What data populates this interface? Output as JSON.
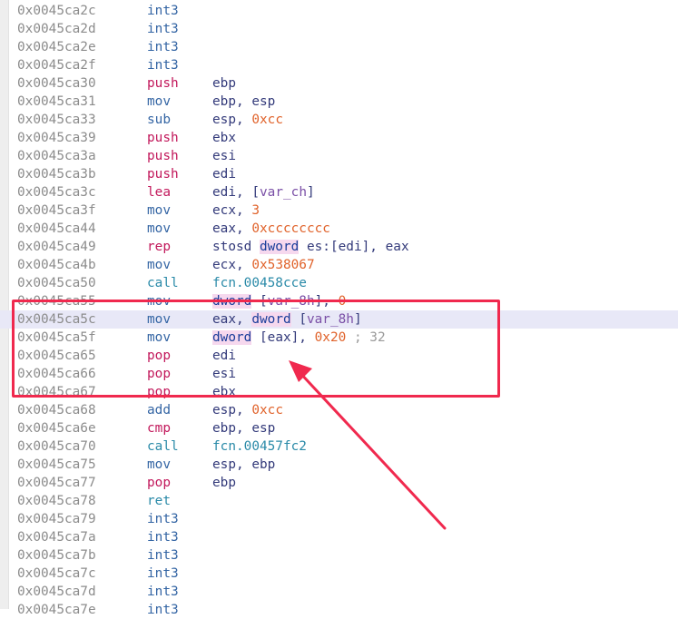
{
  "colors": {
    "highlight_box": "#f0294e",
    "selected_row": "#e8e8f7",
    "address": "#8c8c8c",
    "number": "#e0622a",
    "variable": "#7a4fa6"
  },
  "rows": [
    {
      "addr": "0x0045ca2c",
      "mn": "int3",
      "cls": "int",
      "ops": []
    },
    {
      "addr": "0x0045ca2d",
      "mn": "int3",
      "cls": "int",
      "ops": []
    },
    {
      "addr": "0x0045ca2e",
      "mn": "int3",
      "cls": "int",
      "ops": []
    },
    {
      "addr": "0x0045ca2f",
      "mn": "int3",
      "cls": "int",
      "ops": []
    },
    {
      "addr": "0x0045ca30",
      "mn": "push",
      "cls": "push",
      "ops": [
        [
          "reg",
          "ebp"
        ]
      ]
    },
    {
      "addr": "0x0045ca31",
      "mn": "mov",
      "cls": "mov",
      "ops": [
        [
          "reg",
          "ebp"
        ],
        [
          "punc",
          ", "
        ],
        [
          "reg",
          "esp"
        ]
      ]
    },
    {
      "addr": "0x0045ca33",
      "mn": "sub",
      "cls": "sub",
      "ops": [
        [
          "reg",
          "esp"
        ],
        [
          "punc",
          ", "
        ],
        [
          "num",
          "0xcc"
        ]
      ]
    },
    {
      "addr": "0x0045ca39",
      "mn": "push",
      "cls": "push",
      "ops": [
        [
          "reg",
          "ebx"
        ]
      ]
    },
    {
      "addr": "0x0045ca3a",
      "mn": "push",
      "cls": "push",
      "ops": [
        [
          "reg",
          "esi"
        ]
      ]
    },
    {
      "addr": "0x0045ca3b",
      "mn": "push",
      "cls": "push",
      "ops": [
        [
          "reg",
          "edi"
        ]
      ]
    },
    {
      "addr": "0x0045ca3c",
      "mn": "lea",
      "cls": "lea",
      "ops": [
        [
          "reg",
          "edi"
        ],
        [
          "punc",
          ", ["
        ],
        [
          "var",
          "var_ch"
        ],
        [
          "punc",
          "]"
        ]
      ]
    },
    {
      "addr": "0x0045ca3f",
      "mn": "mov",
      "cls": "mov",
      "ops": [
        [
          "reg",
          "ecx"
        ],
        [
          "punc",
          ", "
        ],
        [
          "num",
          "3"
        ]
      ]
    },
    {
      "addr": "0x0045ca44",
      "mn": "mov",
      "cls": "mov",
      "ops": [
        [
          "reg",
          "eax"
        ],
        [
          "punc",
          ", "
        ],
        [
          "num",
          "0xcccccccc"
        ]
      ]
    },
    {
      "addr": "0x0045ca49",
      "mn": "rep",
      "cls": "rep",
      "ops": [
        [
          "reg",
          "stosd "
        ],
        [
          "kw",
          "dword"
        ],
        [
          "punc",
          " es:[edi], eax"
        ]
      ]
    },
    {
      "addr": "0x0045ca4b",
      "mn": "mov",
      "cls": "mov",
      "ops": [
        [
          "reg",
          "ecx"
        ],
        [
          "punc",
          ", "
        ],
        [
          "num",
          "0x538067"
        ]
      ]
    },
    {
      "addr": "0x0045ca50",
      "mn": "call",
      "cls": "call",
      "ops": [
        [
          "fcn",
          "fcn.00458cce"
        ]
      ]
    },
    {
      "addr": "0x0045ca55",
      "mn": "mov",
      "cls": "mov",
      "ops": [
        [
          "kw",
          "dword"
        ],
        [
          "punc",
          " ["
        ],
        [
          "var",
          "var_8h"
        ],
        [
          "punc",
          "], "
        ],
        [
          "num",
          "0"
        ]
      ]
    },
    {
      "addr": "0x0045ca5c",
      "mn": "mov",
      "cls": "mov",
      "hl": true,
      "ops": [
        [
          "reg",
          "eax"
        ],
        [
          "punc",
          ", "
        ],
        [
          "kw",
          "dword"
        ],
        [
          "punc",
          " ["
        ],
        [
          "var",
          "var_8h"
        ],
        [
          "punc",
          "]"
        ]
      ]
    },
    {
      "addr": "0x0045ca5f",
      "mn": "mov",
      "cls": "mov",
      "ops": [
        [
          "kw",
          "dword"
        ],
        [
          "punc",
          " [eax], "
        ],
        [
          "num",
          "0x20"
        ],
        [
          "cmt",
          " ; 32"
        ]
      ]
    },
    {
      "addr": "0x0045ca65",
      "mn": "pop",
      "cls": "pop",
      "ops": [
        [
          "reg",
          "edi"
        ]
      ]
    },
    {
      "addr": "0x0045ca66",
      "mn": "pop",
      "cls": "pop",
      "ops": [
        [
          "reg",
          "esi"
        ]
      ]
    },
    {
      "addr": "0x0045ca67",
      "mn": "pop",
      "cls": "pop",
      "ops": [
        [
          "reg",
          "ebx"
        ]
      ]
    },
    {
      "addr": "0x0045ca68",
      "mn": "add",
      "cls": "add",
      "ops": [
        [
          "reg",
          "esp"
        ],
        [
          "punc",
          ", "
        ],
        [
          "num",
          "0xcc"
        ]
      ]
    },
    {
      "addr": "0x0045ca6e",
      "mn": "cmp",
      "cls": "cmp",
      "ops": [
        [
          "reg",
          "ebp"
        ],
        [
          "punc",
          ", "
        ],
        [
          "reg",
          "esp"
        ]
      ]
    },
    {
      "addr": "0x0045ca70",
      "mn": "call",
      "cls": "call",
      "ops": [
        [
          "fcn",
          "fcn.00457fc2"
        ]
      ]
    },
    {
      "addr": "0x0045ca75",
      "mn": "mov",
      "cls": "mov",
      "ops": [
        [
          "reg",
          "esp"
        ],
        [
          "punc",
          ", "
        ],
        [
          "reg",
          "ebp"
        ]
      ]
    },
    {
      "addr": "0x0045ca77",
      "mn": "pop",
      "cls": "pop",
      "ops": [
        [
          "reg",
          "ebp"
        ]
      ]
    },
    {
      "addr": "0x0045ca78",
      "mn": "ret",
      "cls": "ret",
      "ops": []
    },
    {
      "addr": "0x0045ca79",
      "mn": "int3",
      "cls": "int",
      "ops": []
    },
    {
      "addr": "0x0045ca7a",
      "mn": "int3",
      "cls": "int",
      "ops": []
    },
    {
      "addr": "0x0045ca7b",
      "mn": "int3",
      "cls": "int",
      "ops": []
    },
    {
      "addr": "0x0045ca7c",
      "mn": "int3",
      "cls": "int",
      "ops": []
    },
    {
      "addr": "0x0045ca7d",
      "mn": "int3",
      "cls": "int",
      "ops": []
    },
    {
      "addr": "0x0045ca7e",
      "mn": "int3",
      "cls": "int",
      "ops": []
    }
  ]
}
